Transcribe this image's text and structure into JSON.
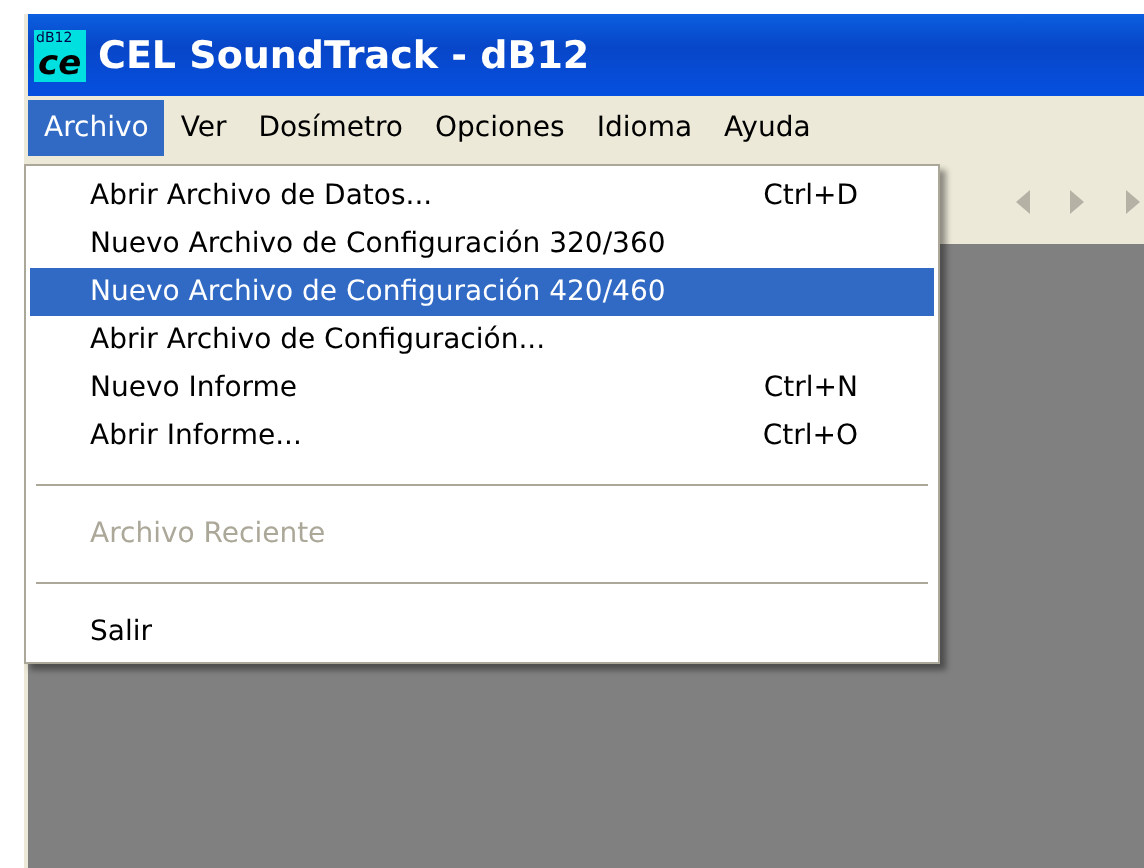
{
  "window": {
    "title": "CEL SoundTrack - dB12",
    "app_icon": {
      "badge": "dB12",
      "letters": "ce"
    }
  },
  "menu_bar": [
    {
      "label": "Archivo",
      "selected": true
    },
    {
      "label": "Ver",
      "selected": false
    },
    {
      "label": "Dosímetro",
      "selected": false
    },
    {
      "label": "Opciones",
      "selected": false
    },
    {
      "label": "Idioma",
      "selected": false
    },
    {
      "label": "Ayuda",
      "selected": false
    }
  ],
  "menu": [
    {
      "kind": "item",
      "label": "Abrir Archivo de Datos...",
      "shortcut": "Ctrl+D",
      "selected": false,
      "disabled": false
    },
    {
      "kind": "item",
      "label": "Nuevo Archivo de Configuración 320/360",
      "selected": false,
      "disabled": false
    },
    {
      "kind": "item",
      "label": "Nuevo Archivo de Configuración 420/460",
      "selected": true,
      "disabled": false
    },
    {
      "kind": "item",
      "label": "Abrir Archivo de Configuración...",
      "selected": false,
      "disabled": false
    },
    {
      "kind": "item",
      "label": "Nuevo Informe",
      "shortcut": "Ctrl+N",
      "selected": false,
      "disabled": false
    },
    {
      "kind": "item",
      "label": "Abrir Informe...",
      "shortcut": "Ctrl+O",
      "selected": false,
      "disabled": false
    },
    {
      "kind": "separator"
    },
    {
      "kind": "item",
      "label": "Archivo Reciente",
      "selected": false,
      "disabled": true
    },
    {
      "kind": "separator"
    },
    {
      "kind": "item",
      "label": "Salir",
      "selected": false,
      "disabled": false
    }
  ]
}
